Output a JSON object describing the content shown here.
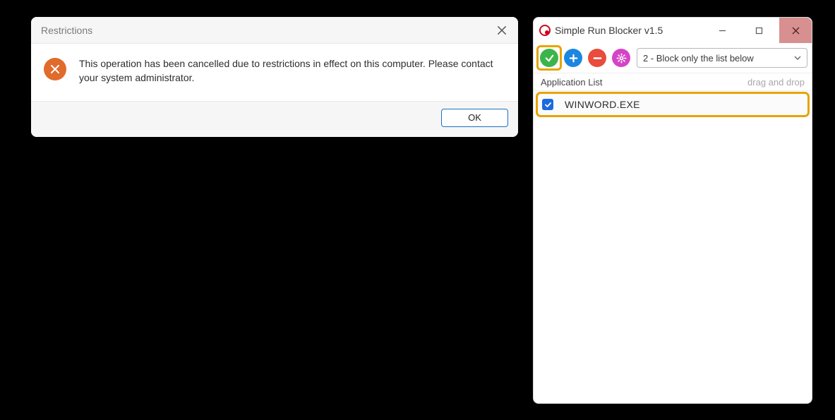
{
  "dialog": {
    "title": "Restrictions",
    "message": "This operation has been cancelled due to restrictions in effect on this computer. Please contact your system administrator.",
    "ok_label": "OK"
  },
  "app": {
    "title": "Simple Run Blocker v1.5",
    "mode_selected": "2 - Block only the list below",
    "list_header": "Application List",
    "list_hint": "drag and drop",
    "items": [
      {
        "name": "WINWORD.EXE",
        "checked": true
      }
    ]
  }
}
